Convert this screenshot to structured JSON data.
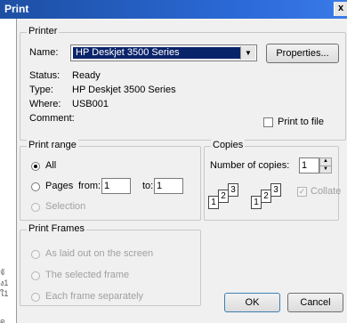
{
  "window": {
    "title": "Print",
    "close_glyph": "x"
  },
  "printer": {
    "legend": "Printer",
    "name_label": "Name:",
    "name_value": "HP Deskjet 3500 Series",
    "properties_label": "Properties...",
    "status_label": "Status:",
    "status_value": "Ready",
    "type_label": "Type:",
    "type_value": "HP Deskjet 3500 Series",
    "where_label": "Where:",
    "where_value": "USB001",
    "comment_label": "Comment:",
    "print_to_file_label": "Print to file",
    "print_to_file_checked": false
  },
  "print_range": {
    "legend": "Print range",
    "all_label": "All",
    "pages_label": "Pages",
    "from_label": "from:",
    "from_value": "1",
    "to_label": "to:",
    "to_value": "1",
    "selection_label": "Selection",
    "selected": "All"
  },
  "copies": {
    "legend": "Copies",
    "number_label": "Number of copies:",
    "number_value": "1",
    "collate_label": "Collate",
    "collate_checked": true,
    "collate_icon_pages": [
      "1",
      "2",
      "3",
      "1",
      "2",
      "3"
    ]
  },
  "print_frames": {
    "legend": "Print Frames",
    "options": [
      "As laid out on the screen",
      "The selected frame",
      "Each frame separately"
    ]
  },
  "buttons": {
    "ok": "OK",
    "cancel": "Cancel"
  },
  "background_text": [
    "จั",
    "ง1",
    "ใ1",
    "ิด"
  ]
}
